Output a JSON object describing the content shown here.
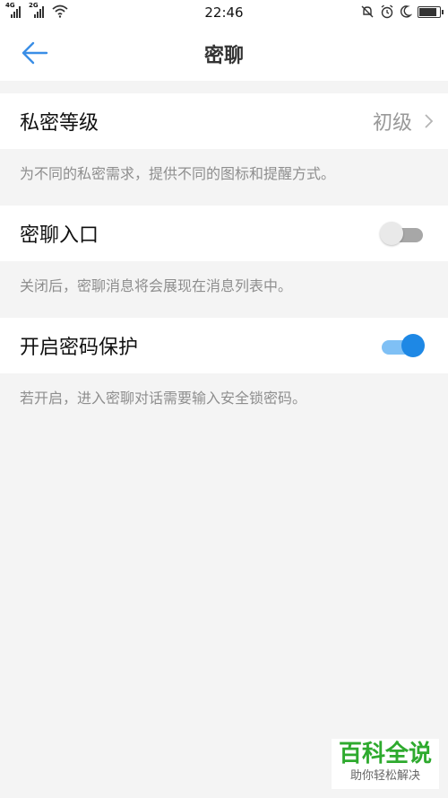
{
  "status_bar": {
    "time": "22:46",
    "signal1_tag": "4G",
    "signal2_tag": "2G",
    "icons": [
      "signal-icon",
      "wifi-icon",
      "mute-bell-icon",
      "alarm-icon",
      "moon-icon",
      "battery-icon"
    ]
  },
  "header": {
    "title": "密聊",
    "back_icon": "back-arrow-icon"
  },
  "settings": {
    "privacy_level": {
      "label": "私密等级",
      "value": "初级",
      "hint": "为不同的私密需求，提供不同的图标和提醒方式。"
    },
    "chat_entrance": {
      "label": "密聊入口",
      "enabled": false,
      "hint": "关闭后，密聊消息将会展现在消息列表中。"
    },
    "password_protect": {
      "label": "开启密码保护",
      "enabled": true,
      "hint": "若开启，进入密聊对话需要输入安全锁密码。"
    }
  },
  "watermark": {
    "title": "百科全说",
    "subtitle": "助你轻松解决"
  },
  "colors": {
    "accent": "#1e88e5",
    "background": "#f4f4f4",
    "hint_text": "#8e8e8e",
    "watermark_green": "#2eaa2e"
  }
}
